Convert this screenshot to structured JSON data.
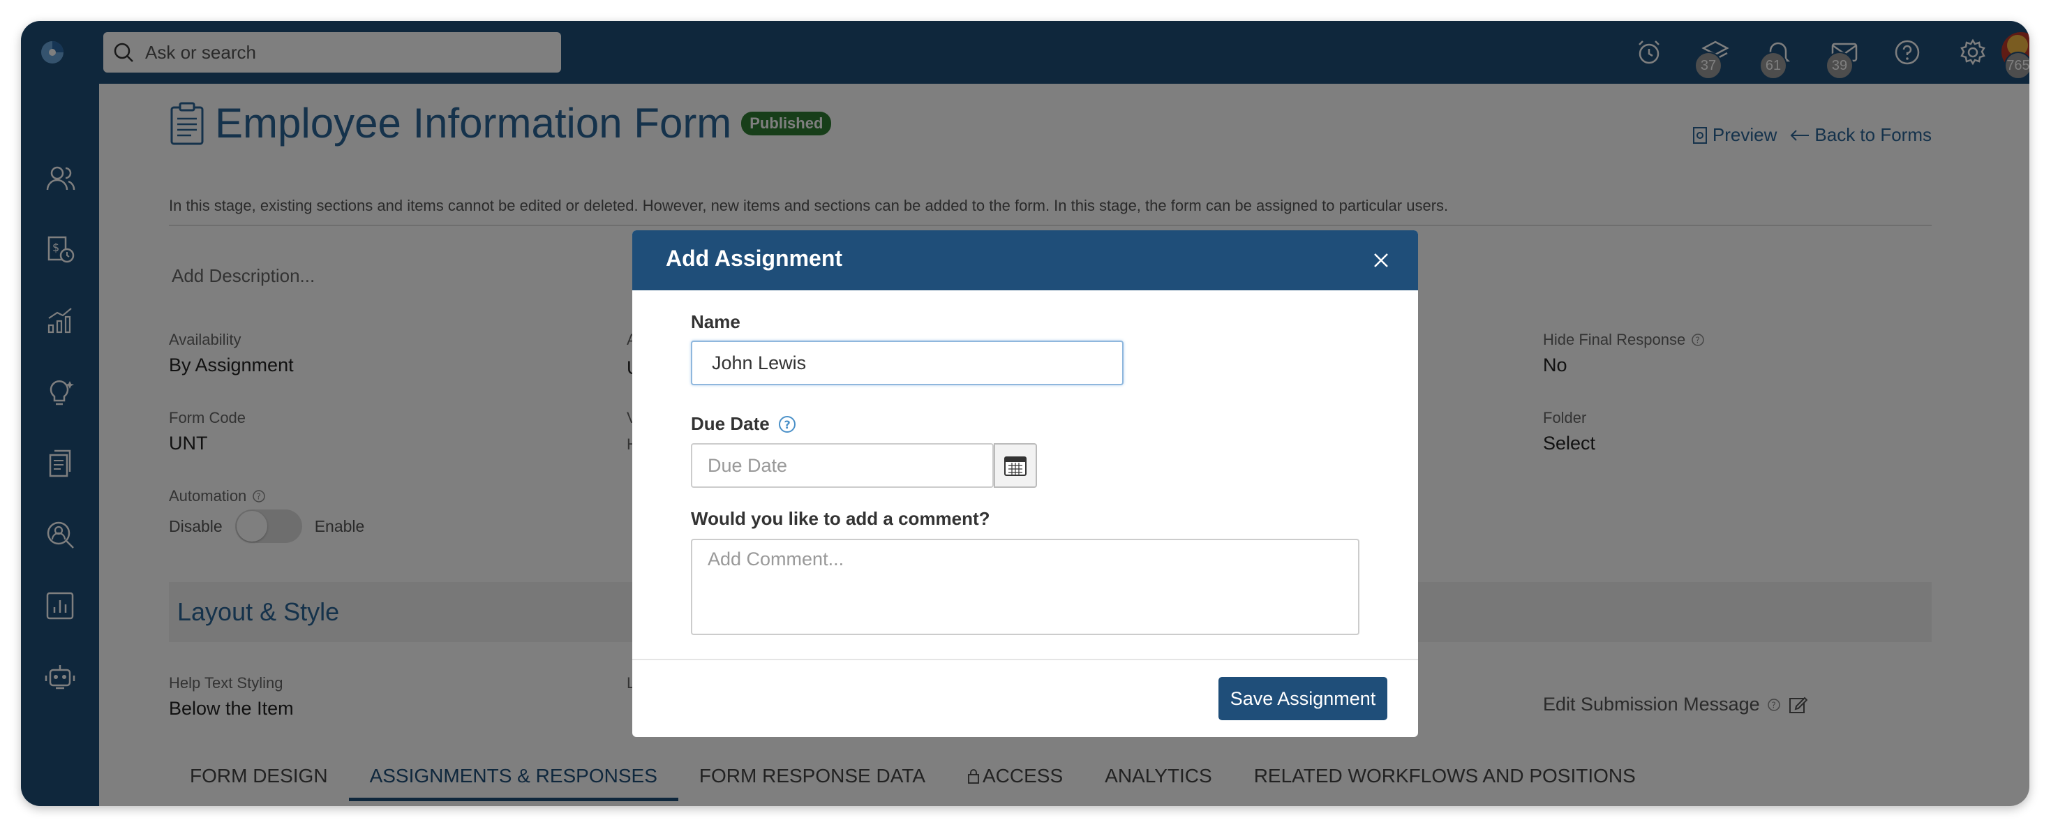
{
  "search": {
    "placeholder": "Ask or search"
  },
  "topbar": {
    "badges": {
      "layers": "37",
      "notifications": "61",
      "mail": "39",
      "avatar": "765"
    }
  },
  "page": {
    "title": "Employee Information Form",
    "status_badge": "Published",
    "preview_label": "Preview",
    "back_label": "Back to Forms",
    "notice": "In this stage, existing sections and items cannot be edited or deleted. However, new items and sections can be added to the form. In this stage, the form can be assigned to particular users.",
    "add_description": "Add Description..."
  },
  "fields": {
    "availability": {
      "label": "Availability",
      "value": "By Assignment"
    },
    "form_code": {
      "label": "Form Code",
      "value": "UNT"
    },
    "hide_final_response": {
      "label": "Hide Final Response",
      "value": "No"
    },
    "folder": {
      "label": "Folder",
      "value": "Select"
    },
    "automation": {
      "label": "Automation",
      "off": "Disable",
      "on": "Enable",
      "enabled": false
    },
    "help_text_styling": {
      "label": "Help Text Styling",
      "value": "Below the Item"
    },
    "partial_col_a": "A",
    "partial_col_u": "U",
    "partial_col_v": "V",
    "partial_col_h": "H",
    "partial_col_l": "L"
  },
  "section": {
    "layout_style": "Layout & Style"
  },
  "edit_submission": "Edit Submission Message",
  "tabs": [
    {
      "label": "FORM DESIGN",
      "active": false
    },
    {
      "label": "ASSIGNMENTS & RESPONSES",
      "active": true
    },
    {
      "label": "FORM RESPONSE DATA",
      "active": false
    },
    {
      "label": "ACCESS",
      "active": false
    },
    {
      "label": "ANALYTICS",
      "active": false
    },
    {
      "label": "RELATED WORKFLOWS AND POSITIONS",
      "active": false
    }
  ],
  "modal": {
    "title": "Add Assignment",
    "name_label": "Name",
    "name_value": "John Lewis",
    "due_date_label": "Due Date",
    "due_date_placeholder": "Due Date",
    "comment_label": "Would you like to add a comment?",
    "comment_placeholder": "Add Comment...",
    "save_label": "Save Assignment"
  },
  "colors": {
    "brand": "#1f4e79",
    "published": "#2e7d32"
  }
}
